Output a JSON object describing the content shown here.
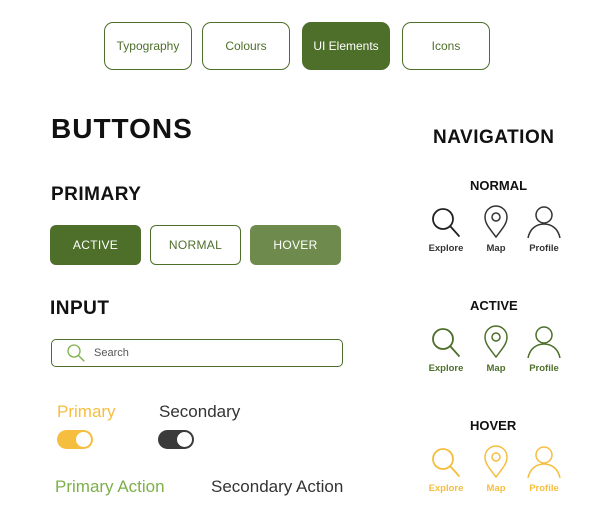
{
  "tabs": [
    "Typography",
    "Colours",
    "UI Elements",
    "Icons"
  ],
  "sections": {
    "buttons": "BUTTONS",
    "primary": "PRIMARY",
    "input": "INPUT",
    "navigation": "NAVIGATION"
  },
  "buttons": {
    "active": "ACTIVE",
    "normal": "NORMAL",
    "hover": "HOVER"
  },
  "search": {
    "placeholder": "Search"
  },
  "toggles": {
    "primary_label": "Primary",
    "secondary_label": "Secondary"
  },
  "actions": {
    "primary": "Primary Action",
    "secondary": "Secondary Action"
  },
  "nav": {
    "states": [
      "NORMAL",
      "ACTIVE",
      "HOVER"
    ],
    "items": [
      "Explore",
      "Map",
      "Profile"
    ]
  },
  "colors": {
    "brand_green": "#4d6f2a",
    "hover_green": "#6e8a4c",
    "yellow": "#f6be3f",
    "action_green": "#7db04a",
    "dark": "#3a3a3a"
  }
}
